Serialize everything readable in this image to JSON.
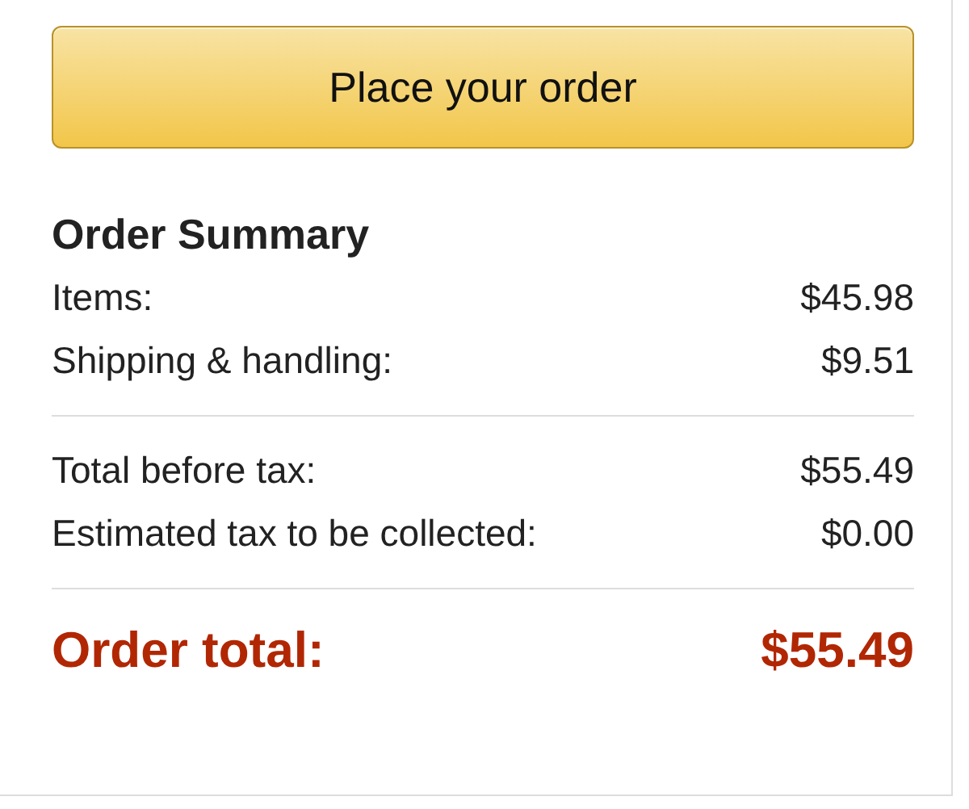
{
  "button": {
    "label": "Place your order"
  },
  "summary": {
    "title": "Order Summary",
    "groups": [
      [
        {
          "label": "Items:",
          "value": "$45.98"
        },
        {
          "label": "Shipping & handling:",
          "value": "$9.51"
        }
      ],
      [
        {
          "label": "Total before tax:",
          "value": "$55.49"
        },
        {
          "label": "Estimated tax to be collected:",
          "value": "$0.00"
        }
      ]
    ],
    "total": {
      "label": "Order total:",
      "value": "$55.49"
    }
  }
}
